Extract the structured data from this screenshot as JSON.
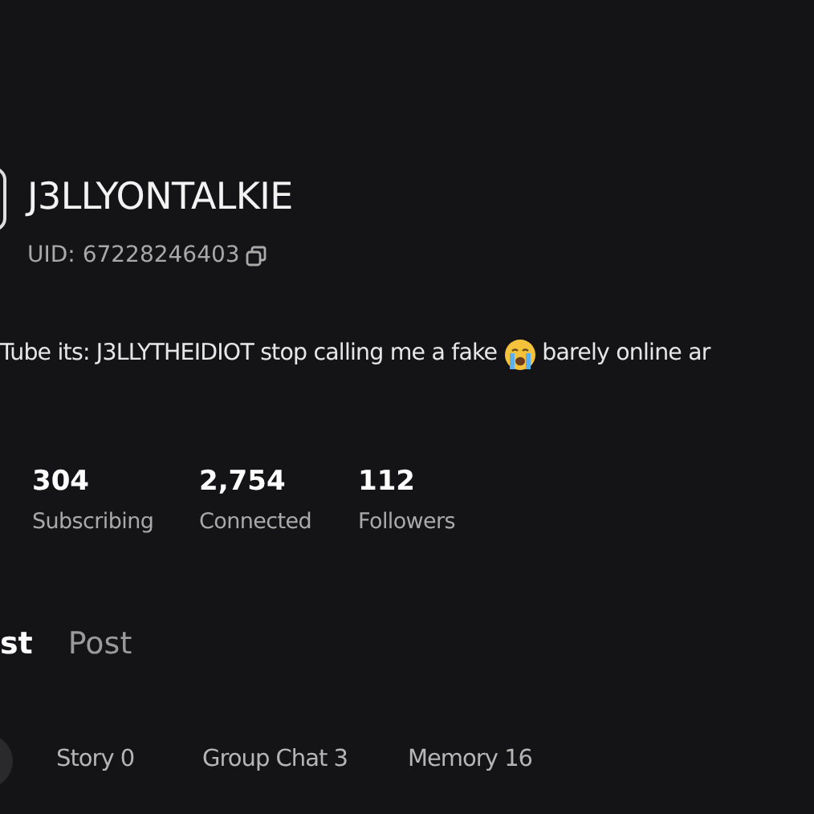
{
  "profile": {
    "name": "J3LLYONTALKIE",
    "uid": "UID: 67228246403"
  },
  "bio": {
    "text_before": "Tube its: J3LLYTHEIDIOT stop calling me a fake",
    "text_after": "barely online ar"
  },
  "stats": [
    {
      "value": "304",
      "label": "Subscribing"
    },
    {
      "value": "2,754",
      "label": "Connected"
    },
    {
      "value": "112",
      "label": "Followers"
    }
  ],
  "tabs": [
    {
      "label": "st",
      "selected": true
    },
    {
      "label": "Post",
      "selected": false
    }
  ],
  "filters": [
    {
      "label": "Story 0"
    },
    {
      "label": "Group Chat 3"
    },
    {
      "label": "Memory 16"
    }
  ]
}
